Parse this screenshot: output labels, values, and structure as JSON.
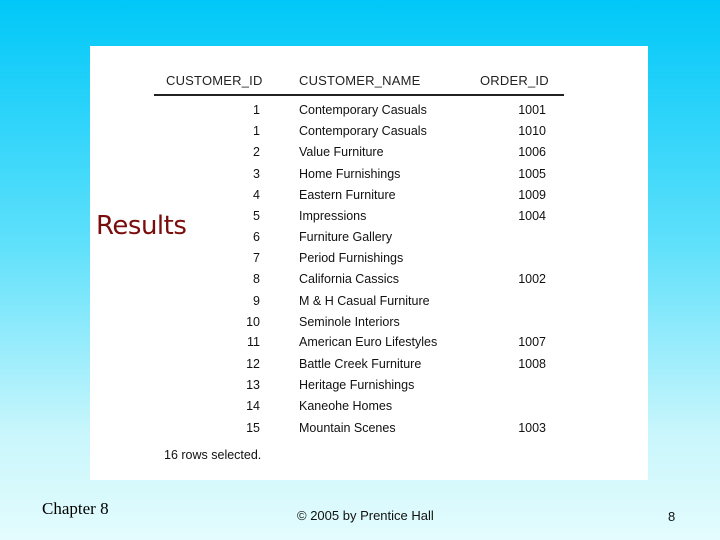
{
  "slide": {
    "title": "Results",
    "footer_left": "Chapter 8",
    "footer_center": "© 2005 by Prentice Hall",
    "page_number": "8"
  },
  "table": {
    "headers": [
      "CUSTOMER_ID",
      "CUSTOMER_NAME",
      "ORDER_ID"
    ],
    "rows": [
      [
        "1",
        "Contemporary Casuals",
        "1001"
      ],
      [
        "1",
        "Contemporary Casuals",
        "1010"
      ],
      [
        "2",
        "Value Furniture",
        "1006"
      ],
      [
        "3",
        "Home Furnishings",
        "1005"
      ],
      [
        "4",
        "Eastern Furniture",
        "1009"
      ],
      [
        "5",
        "Impressions",
        "1004"
      ],
      [
        "6",
        "Furniture Gallery",
        ""
      ],
      [
        "7",
        "Period Furnishings",
        ""
      ],
      [
        "8",
        "California Cassics",
        "1002"
      ],
      [
        "9",
        "M & H Casual Furniture",
        ""
      ],
      [
        "10",
        "Seminole Interiors",
        ""
      ],
      [
        "11",
        "American Euro Lifestyles",
        "1007"
      ],
      [
        "12",
        "Battle Creek Furniture",
        "1008"
      ],
      [
        "13",
        "Heritage Furnishings",
        ""
      ],
      [
        "14",
        "Kaneohe Homes",
        ""
      ],
      [
        "15",
        "Mountain Scenes",
        "1003"
      ]
    ],
    "footer": "16 rows selected."
  },
  "colors": {
    "title": "#7a0c0c",
    "background_top": "#00c8f8",
    "background_bottom": "#e4fcfd"
  }
}
